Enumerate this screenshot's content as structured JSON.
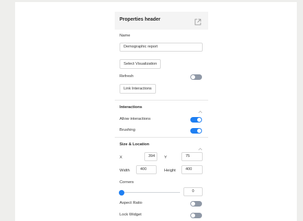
{
  "panel": {
    "header_title": "Properties header",
    "name_label": "Name",
    "name_value": "Demographic report",
    "select_viz_label": "Select Visualization",
    "refresh_label": "Refresh",
    "refresh_on": false,
    "link_interactions_label": "Link Interactions"
  },
  "interactions": {
    "title": "Interactions",
    "allow_label": "Allow interactions",
    "allow_on": true,
    "brushing_label": "Brushing",
    "brushing_on": true
  },
  "size_location": {
    "title": "Size & Location",
    "x_label": "X",
    "x_value": "394",
    "y_label": "Y",
    "y_value": "75",
    "width_label": "Width",
    "width_value": "400",
    "height_label": "Height",
    "height_value": "400",
    "corners_label": "Corners",
    "corners_value": "0",
    "aspect_ratio_label": "Aspect Ratio",
    "aspect_ratio_on": false,
    "lock_widget_label": "Lock Widget",
    "lock_widget_on": false
  },
  "colors": {
    "accent": "#1e7ff2",
    "toggle_off": "#8f98a6"
  },
  "icons": {
    "popout": "external-link-icon",
    "collapse": "chevron-up-icon"
  }
}
